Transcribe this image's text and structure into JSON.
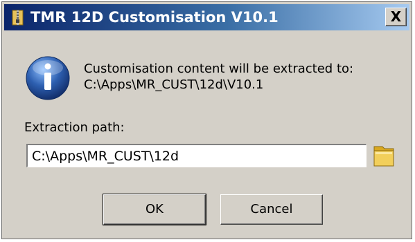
{
  "window": {
    "title": "TMR 12D Customisation V10.1",
    "close_label": "X"
  },
  "message": {
    "line1": "Customisation content will be extracted to:",
    "line2": "C:\\Apps\\MR_CUST\\12d\\V10.1"
  },
  "extraction": {
    "label": "Extraction path:",
    "value": "C:\\Apps\\MR_CUST\\12d"
  },
  "buttons": {
    "ok": "OK",
    "cancel": "Cancel"
  },
  "icons": {
    "app": "zip-folder-icon",
    "info": "info-icon",
    "browse": "folder-icon"
  },
  "colors": {
    "titlebar_start": "#0a246a",
    "titlebar_end": "#a6caf0",
    "dialog_bg": "#d4d0c8",
    "info_blue": "#2d5fb0"
  }
}
